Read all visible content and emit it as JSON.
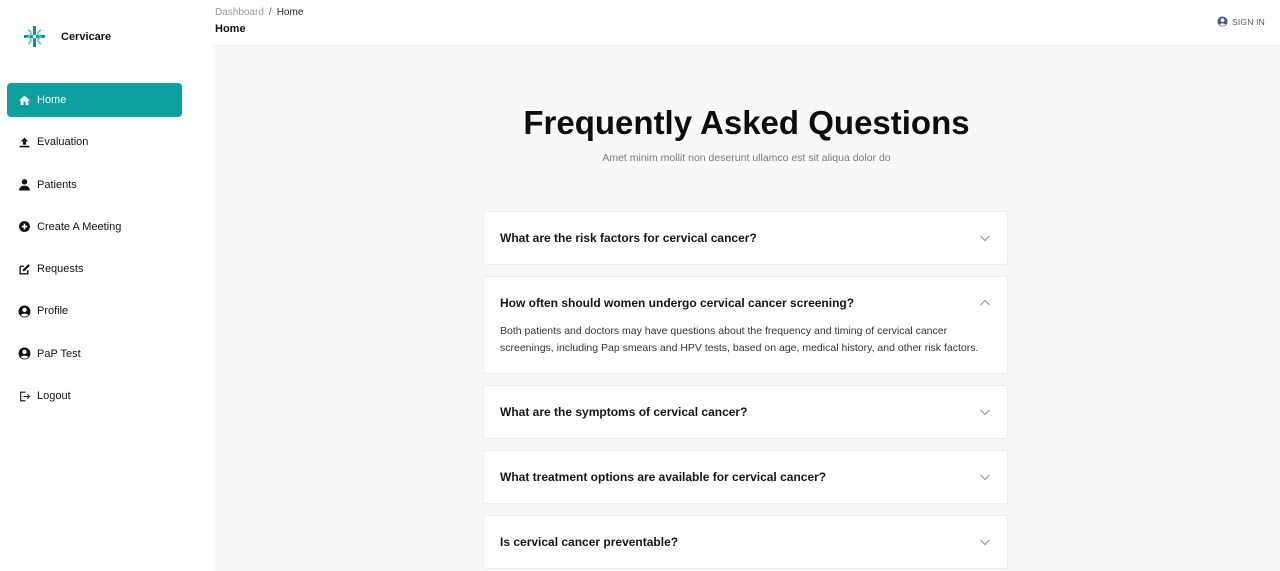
{
  "brand": {
    "name": "Cervicare",
    "accent_color": "#0e9f9f"
  },
  "sidebar": {
    "items": [
      {
        "label": "Home",
        "icon": "home-icon",
        "active": true
      },
      {
        "label": "Evaluation",
        "icon": "upload-icon",
        "active": false
      },
      {
        "label": "Patients",
        "icon": "person-icon",
        "active": false
      },
      {
        "label": "Create A Meeting",
        "icon": "plus-circle-icon",
        "active": false
      },
      {
        "label": "Requests",
        "icon": "edit-icon",
        "active": false
      },
      {
        "label": "Profile",
        "icon": "account-circle-icon",
        "active": false
      },
      {
        "label": "PaP Test",
        "icon": "account-circle-icon",
        "active": false
      },
      {
        "label": "Logout",
        "icon": "logout-icon",
        "active": false
      }
    ]
  },
  "header": {
    "breadcrumb": {
      "root": "Dashboard",
      "separator": "/",
      "current": "Home"
    },
    "page_title": "Home",
    "sign_in_label": "SIGN IN"
  },
  "faq": {
    "heading": "Frequently Asked Questions",
    "subtitle": "Amet minim mollit non deserunt ullamco est sit aliqua dolor do",
    "items": [
      {
        "question": "What are the risk factors for cervical cancer?",
        "expanded": false,
        "answer": ""
      },
      {
        "question": "How often should women undergo cervical cancer screening?",
        "expanded": true,
        "answer": "Both patients and doctors may have questions about the frequency and timing of cervical cancer screenings, including Pap smears and HPV tests, based on age, medical history, and other risk factors."
      },
      {
        "question": "What are the symptoms of cervical cancer?",
        "expanded": false,
        "answer": ""
      },
      {
        "question": "What treatment options are available for cervical cancer?",
        "expanded": false,
        "answer": ""
      },
      {
        "question": "Is cervical cancer preventable?",
        "expanded": false,
        "answer": ""
      }
    ]
  }
}
